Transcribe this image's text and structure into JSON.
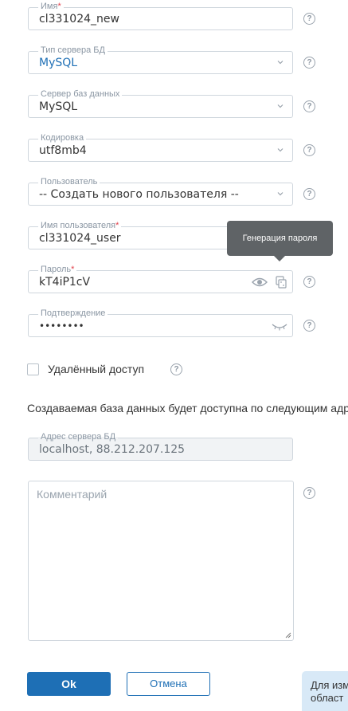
{
  "form": {
    "name": {
      "label": "Имя",
      "required": "*",
      "value": "cl331024_new"
    },
    "db_type": {
      "label": "Тип сервера БД",
      "value": "MySQL"
    },
    "db_server": {
      "label": "Сервер баз данных",
      "value": "MySQL"
    },
    "encoding": {
      "label": "Кодировка",
      "value": "utf8mb4"
    },
    "user": {
      "label": "Пользователь",
      "value": "-- Создать нового пользователя --"
    },
    "username": {
      "label": "Имя пользователя",
      "required": "*",
      "value": "cl331024_user"
    },
    "password": {
      "label": "Пароль",
      "required": "*",
      "value": "kT4iP1cV"
    },
    "confirm": {
      "label": "Подтверждение",
      "value": "••••••••"
    },
    "remote_access": {
      "label": "Удалённый доступ",
      "checked": false
    },
    "info_text": "Создаваемая база данных будет доступна по следующим адр",
    "db_address": {
      "label": "Адрес сервера БД",
      "value": "localhost, 88.212.207.125"
    },
    "comment": {
      "placeholder": "Комментарий"
    }
  },
  "tooltip": {
    "text": "Генерация пароля"
  },
  "buttons": {
    "ok": "Ok",
    "cancel": "Отмена"
  },
  "side_note": {
    "text": "Для изм\nобласт"
  },
  "help_glyph": "?",
  "colors": {
    "accent": "#1e6fb5",
    "border": "#cfd6dd",
    "tooltip_bg": "#5f6366",
    "required": "#e2404b",
    "note_bg": "#d8e9f7"
  }
}
